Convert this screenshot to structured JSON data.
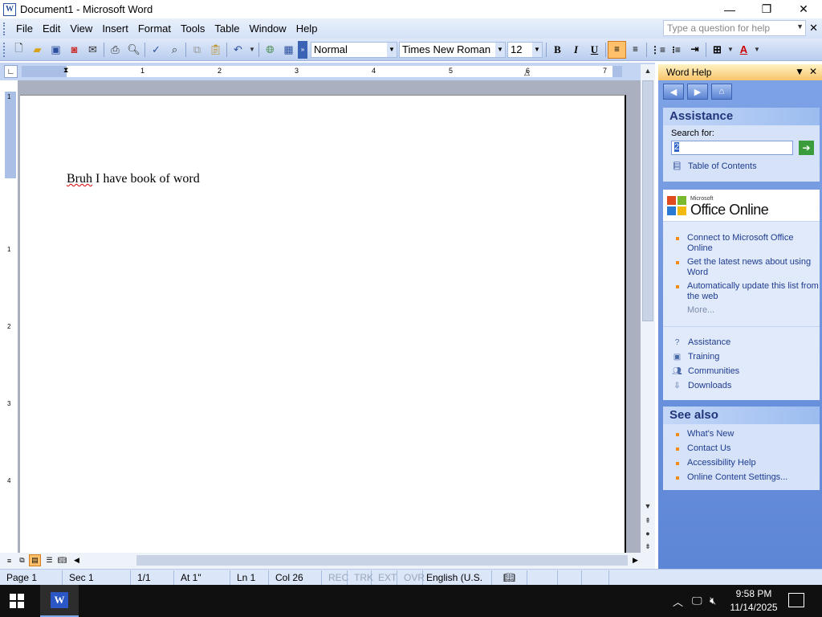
{
  "window": {
    "title": "Document1 - Microsoft Word",
    "icon_letter": "W",
    "min": "—",
    "max": "❐",
    "close": "✕"
  },
  "menu": {
    "items": [
      {
        "label": "File"
      },
      {
        "label": "Edit"
      },
      {
        "label": "View"
      },
      {
        "label": "Insert"
      },
      {
        "label": "Format"
      },
      {
        "label": "Tools"
      },
      {
        "label": "Table"
      },
      {
        "label": "Window"
      },
      {
        "label": "Help"
      }
    ],
    "help_placeholder": "Type a question for help",
    "close": "✕"
  },
  "toolbar": {
    "style": "Normal",
    "font": "Times New Roman",
    "size": "12",
    "bold": "B",
    "italic": "I",
    "underline": "U"
  },
  "ruler": {
    "numbers": [
      "1",
      "2",
      "3",
      "4",
      "5",
      "6",
      "7"
    ],
    "vnumbers": [
      "1",
      "1",
      "2",
      "3",
      "4"
    ]
  },
  "document": {
    "text_misspelled": "Bruh",
    "text_rest": " I have book of word"
  },
  "taskpane": {
    "title": "Word Help",
    "assistance_title": "Assistance",
    "search_label": "Search for:",
    "search_value": "2",
    "toc": "Table of Contents",
    "office_online_small": "Microsoft",
    "office_online": "Office Online",
    "online_links": [
      "Connect to Microsoft Office Online",
      "Get the latest news about using Word",
      "Automatically update this list from the web"
    ],
    "more": "More...",
    "icon_links": [
      "Assistance",
      "Training",
      "Communities",
      "Downloads"
    ],
    "see_also_title": "See also",
    "see_also": [
      "What's New",
      "Contact Us",
      "Accessibility Help",
      "Online Content Settings..."
    ]
  },
  "status": {
    "page": "Page 1",
    "sec": "Sec 1",
    "pages": "1/1",
    "at": "At 1\"",
    "ln": "Ln 1",
    "col": "Col 26",
    "rec": "REC",
    "trk": "TRK",
    "ext": "EXT",
    "ovr": "OVR",
    "lang": "English (U.S."
  },
  "taskbar": {
    "time": "9:58 PM",
    "date": "11/14/2025",
    "word_letter": "W"
  }
}
